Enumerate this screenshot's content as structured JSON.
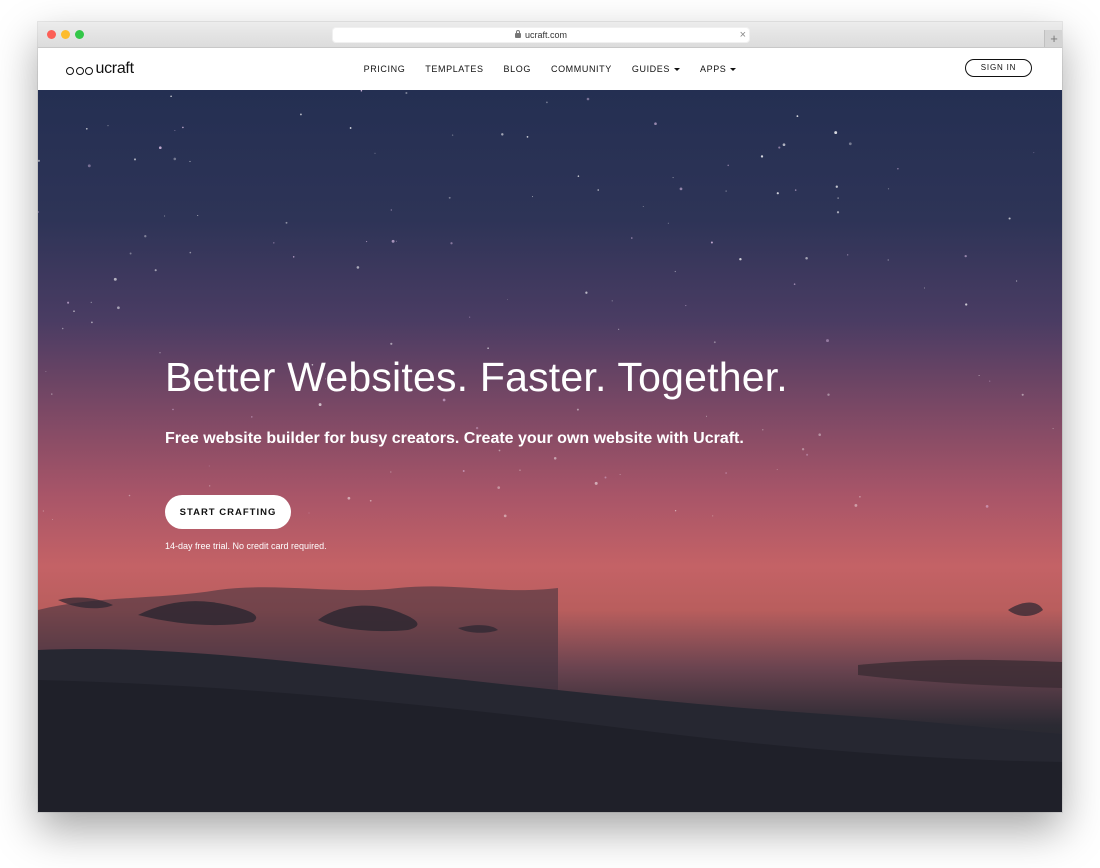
{
  "browser": {
    "url": "ucraft.com",
    "newtab_glyph": "+",
    "close_glyph": "×"
  },
  "nav": {
    "logo_text": "ucraft",
    "items": [
      "PRICING",
      "TEMPLATES",
      "BLOG",
      "COMMUNITY",
      "GUIDES",
      "APPS"
    ],
    "sign_in": "SIGN IN"
  },
  "hero": {
    "headline": "Better Websites. Faster. Together.",
    "subhead": "Free website builder for busy creators. Create your own website with Ucraft.",
    "cta": "START CRAFTING",
    "note": "14-day free trial. No credit card required."
  },
  "colors": {
    "sky_top": "#242f52",
    "sky_mid": "#a85568",
    "horizon": "#c46266",
    "ground": "#1f2129"
  },
  "icons": {
    "lock": "lock-icon",
    "dropdown": "caret-down-icon"
  }
}
